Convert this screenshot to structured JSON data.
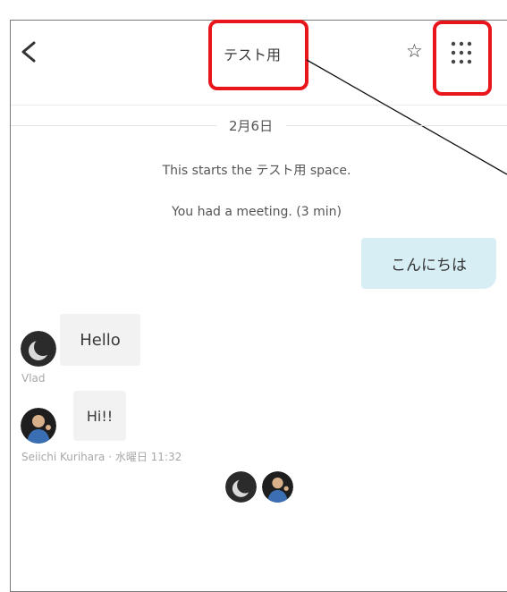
{
  "header": {
    "title": "テスト用",
    "back_icon": "chevron-left-icon",
    "star_icon": "star-outline-icon",
    "star_glyph": "☆",
    "apps_icon": "grid-dots-icon"
  },
  "conversation": {
    "date": "2月6日",
    "start_notice": "This starts the テスト用 space.",
    "meeting_notice": "You had a meeting. (3 min)",
    "messages": [
      {
        "text": "こんにちは",
        "direction": "outgoing"
      },
      {
        "text": "Hello",
        "direction": "incoming",
        "sender": "Vlad"
      },
      {
        "text": "Hi!!",
        "direction": "incoming",
        "sender": "Seiichi Kurihara · 水曜日 11:32"
      }
    ]
  },
  "colors": {
    "outgoing_bubble": "#d8eef5",
    "incoming_bubble": "#f2f2f2",
    "annotation": "#e8151b"
  }
}
